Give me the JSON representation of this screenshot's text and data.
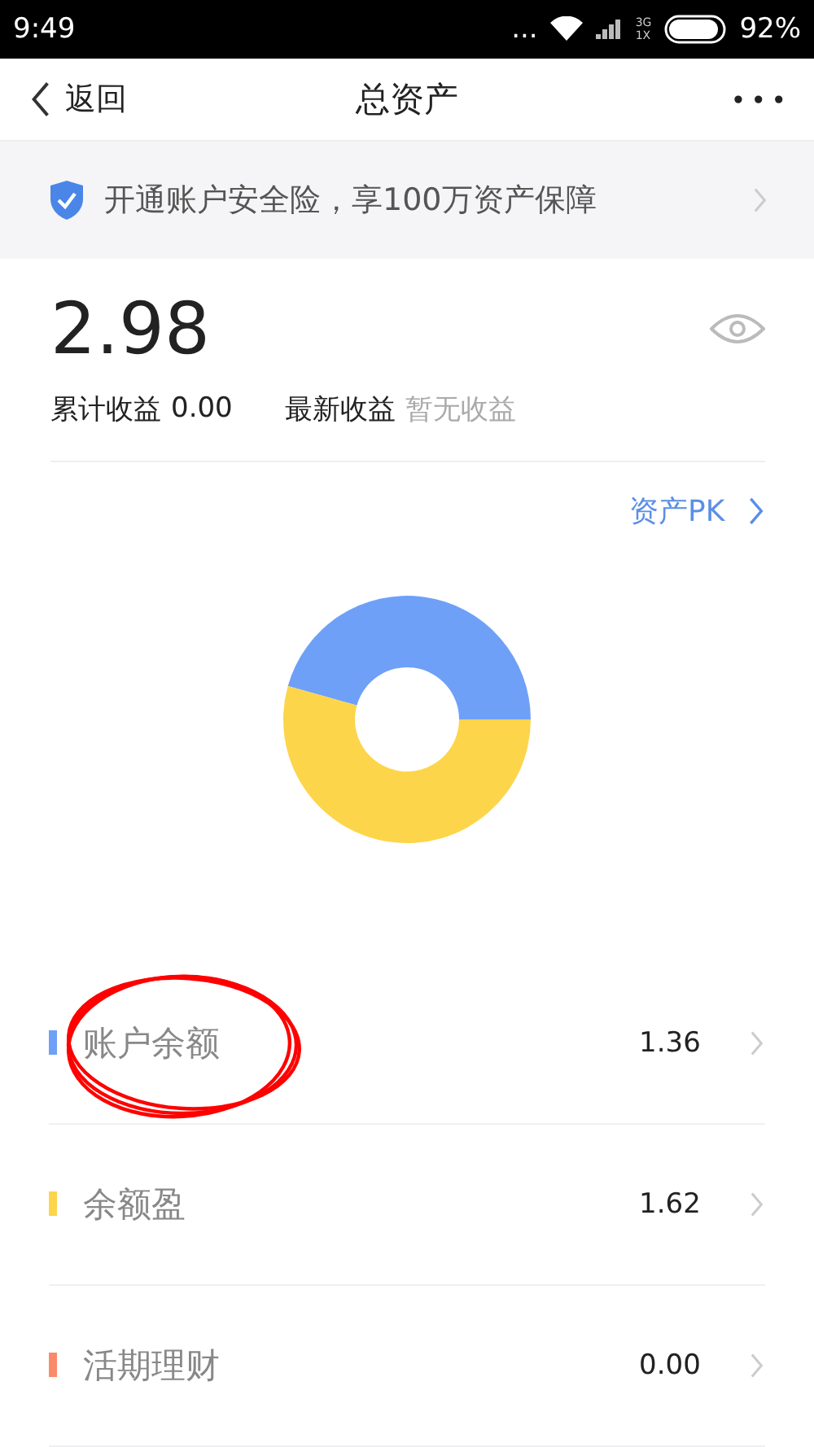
{
  "status_bar": {
    "time": "9:49",
    "dots": "...",
    "network": "3G",
    "network_sub": "1X",
    "battery": "92%"
  },
  "nav": {
    "back": "返回",
    "title": "总资产",
    "more": "•••"
  },
  "banner": {
    "text": "开通账户安全险，享100万资产保障"
  },
  "summary": {
    "total": "2.98",
    "accumulated_label": "累计收益",
    "accumulated_value": "0.00",
    "latest_label": "最新收益",
    "latest_value": "暂无收益"
  },
  "pk_link": "资产PK",
  "chart": {
    "chart_data": {
      "type": "donut",
      "series": [
        {
          "values": [
            45.64,
            54.36,
            0
          ]
        }
      ]
    }
  },
  "assets": [
    {
      "name": "账户余额",
      "amount": "1.36",
      "color": "#6fa0f7",
      "circled": true
    },
    {
      "name": "余额盈",
      "amount": "1.62",
      "color": "#fdd54a",
      "circled": false
    },
    {
      "name": "活期理财",
      "amount": "0.00",
      "color": "#fb8a6a",
      "circled": false
    }
  ]
}
